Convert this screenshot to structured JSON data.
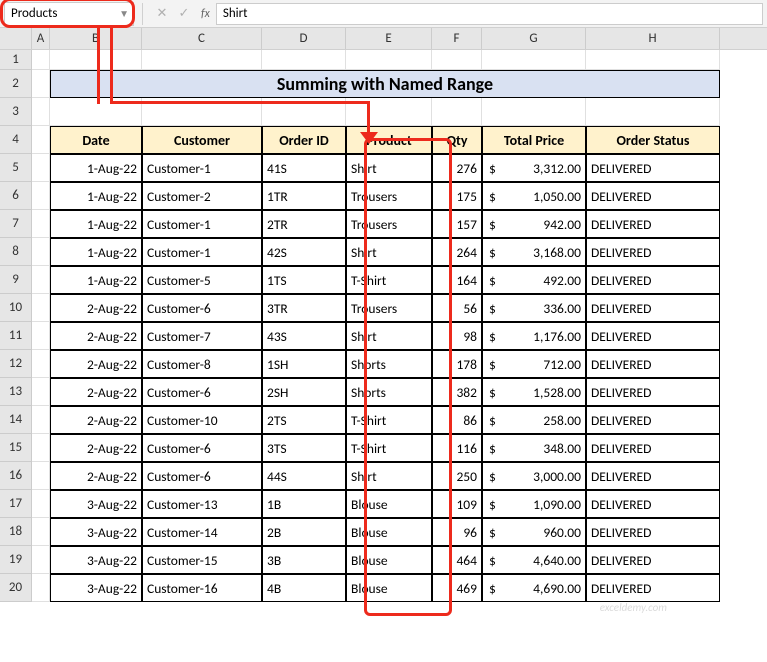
{
  "name_box": "Products",
  "formula_input": "Shirt",
  "fx": "fx",
  "col_labels": [
    "A",
    "B",
    "C",
    "D",
    "E",
    "F",
    "G",
    "H"
  ],
  "row_labels": [
    "1",
    "2",
    "3",
    "4",
    "5",
    "6",
    "7",
    "8",
    "9",
    "10",
    "11",
    "12",
    "13",
    "14",
    "15",
    "16",
    "17",
    "18",
    "19",
    "20"
  ],
  "title": "Summing with Named Range",
  "headers": [
    "Date",
    "Customer",
    "Order ID",
    "Product",
    "Qty",
    "Total Price",
    "Order Status"
  ],
  "cur": "$",
  "rows": [
    {
      "date": "1-Aug-22",
      "cust": "Customer-1",
      "oid": "41S",
      "prod": "Shirt",
      "qty": "276",
      "price": "3,312.00",
      "status": "DELIVERED"
    },
    {
      "date": "1-Aug-22",
      "cust": "Customer-2",
      "oid": "1TR",
      "prod": "Trousers",
      "qty": "175",
      "price": "1,050.00",
      "status": "DELIVERED"
    },
    {
      "date": "1-Aug-22",
      "cust": "Customer-1",
      "oid": "2TR",
      "prod": "Trousers",
      "qty": "157",
      "price": "942.00",
      "status": "DELIVERED"
    },
    {
      "date": "1-Aug-22",
      "cust": "Customer-1",
      "oid": "42S",
      "prod": "Shirt",
      "qty": "264",
      "price": "3,168.00",
      "status": "DELIVERED"
    },
    {
      "date": "1-Aug-22",
      "cust": "Customer-5",
      "oid": "1TS",
      "prod": "T-Shirt",
      "qty": "164",
      "price": "492.00",
      "status": "DELIVERED"
    },
    {
      "date": "2-Aug-22",
      "cust": "Customer-6",
      "oid": "3TR",
      "prod": "Trousers",
      "qty": "56",
      "price": "336.00",
      "status": "DELIVERED"
    },
    {
      "date": "2-Aug-22",
      "cust": "Customer-7",
      "oid": "43S",
      "prod": "Shirt",
      "qty": "98",
      "price": "1,176.00",
      "status": "DELIVERED"
    },
    {
      "date": "2-Aug-22",
      "cust": "Customer-8",
      "oid": "1SH",
      "prod": "Shorts",
      "qty": "178",
      "price": "712.00",
      "status": "DELIVERED"
    },
    {
      "date": "2-Aug-22",
      "cust": "Customer-6",
      "oid": "2SH",
      "prod": "Shorts",
      "qty": "382",
      "price": "1,528.00",
      "status": "DELIVERED"
    },
    {
      "date": "2-Aug-22",
      "cust": "Customer-10",
      "oid": "2TS",
      "prod": "T-Shirt",
      "qty": "86",
      "price": "258.00",
      "status": "DELIVERED"
    },
    {
      "date": "2-Aug-22",
      "cust": "Customer-6",
      "oid": "3TS",
      "prod": "T-Shirt",
      "qty": "116",
      "price": "348.00",
      "status": "DELIVERED"
    },
    {
      "date": "2-Aug-22",
      "cust": "Customer-6",
      "oid": "44S",
      "prod": "Shirt",
      "qty": "250",
      "price": "3,000.00",
      "status": "DELIVERED"
    },
    {
      "date": "3-Aug-22",
      "cust": "Customer-13",
      "oid": "1B",
      "prod": "Blouse",
      "qty": "109",
      "price": "1,090.00",
      "status": "DELIVERED"
    },
    {
      "date": "3-Aug-22",
      "cust": "Customer-14",
      "oid": "2B",
      "prod": "Blouse",
      "qty": "96",
      "price": "960.00",
      "status": "DELIVERED"
    },
    {
      "date": "3-Aug-22",
      "cust": "Customer-15",
      "oid": "3B",
      "prod": "Blouse",
      "qty": "464",
      "price": "4,640.00",
      "status": "DELIVERED"
    },
    {
      "date": "3-Aug-22",
      "cust": "Customer-16",
      "oid": "4B",
      "prod": "Blouse",
      "qty": "469",
      "price": "4,690.00",
      "status": "DELIVERED"
    }
  ],
  "watermark": "exceldemy.com"
}
